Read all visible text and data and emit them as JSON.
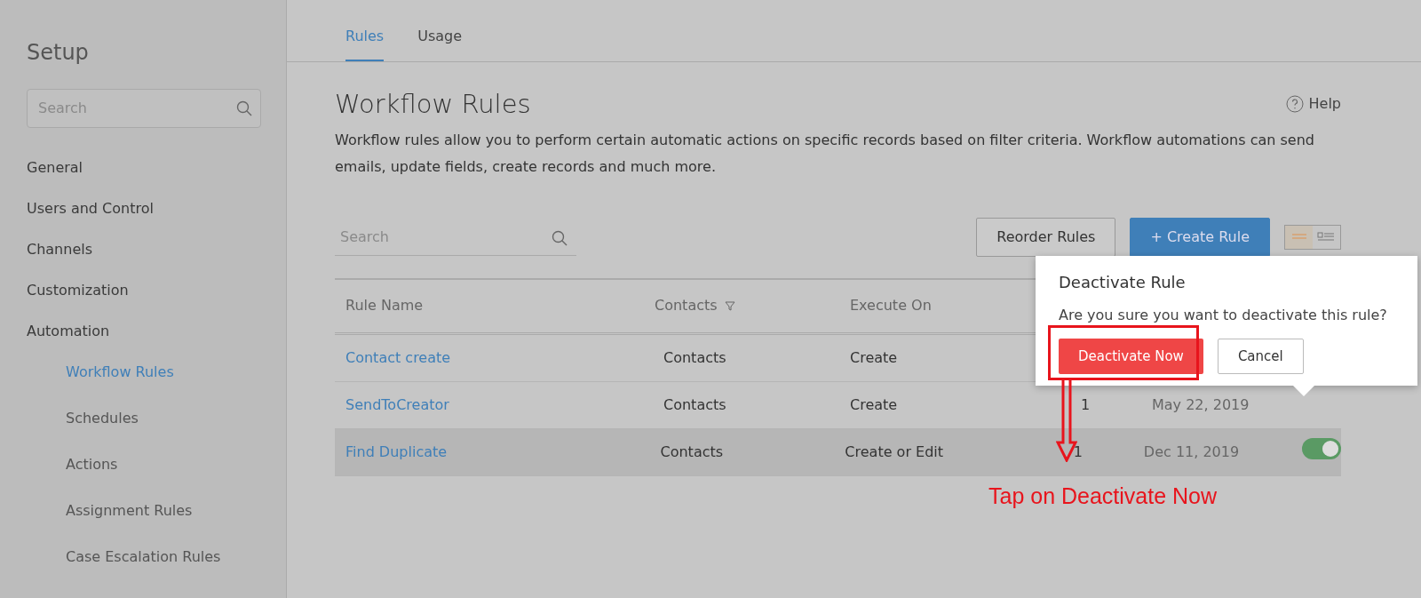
{
  "sidebar": {
    "title": "Setup",
    "search": {
      "placeholder": "Search"
    },
    "items": [
      {
        "label": "General"
      },
      {
        "label": "Users and Control"
      },
      {
        "label": "Channels"
      },
      {
        "label": "Customization"
      },
      {
        "label": "Automation",
        "children": [
          {
            "label": "Workflow Rules",
            "selected": true
          },
          {
            "label": "Schedules",
            "selected": false
          },
          {
            "label": "Actions",
            "selected": false
          },
          {
            "label": "Assignment Rules",
            "selected": false
          },
          {
            "label": "Case Escalation Rules",
            "selected": false
          }
        ]
      }
    ]
  },
  "tabs": [
    {
      "label": "Rules",
      "selected": true
    },
    {
      "label": "Usage",
      "selected": false
    }
  ],
  "page": {
    "title": "Workflow Rules",
    "help": "Help",
    "description": "Workflow rules allow you to perform certain automatic actions on specific records based on filter criteria. Workflow automations can send emails, update fields, create records and much more."
  },
  "toolbar": {
    "search": {
      "placeholder": "Search"
    },
    "buttons": [
      {
        "label": "Reorder Rules",
        "kind": "outline"
      },
      {
        "label": "+ Create Rule",
        "kind": "primary"
      }
    ],
    "views": [
      {
        "kind": "list",
        "selected": true
      },
      {
        "kind": "detail",
        "selected": false
      }
    ]
  },
  "table": {
    "columns": [
      "Rule Name",
      "Contacts",
      "Execute On"
    ],
    "rows": [
      {
        "name": "Contact create",
        "module": "Contacts",
        "execute_on": "Create",
        "highlighted": false
      },
      {
        "name": "SendToCreator",
        "module": "Contacts",
        "execute_on": "Create",
        "count": "1",
        "date": "May 22, 2019",
        "highlighted": false
      },
      {
        "name": "Find Duplicate",
        "module": "Contacts",
        "execute_on": "Create or Edit",
        "count": "1",
        "date": "Dec 11, 2019",
        "highlighted": true,
        "toggle": {
          "on": true
        }
      }
    ]
  },
  "dialog": {
    "title": "Deactivate Rule",
    "message": "Are you sure you want to deactivate this rule?",
    "buttons": [
      {
        "label": "Deactivate Now",
        "kind": "danger"
      },
      {
        "label": "Cancel",
        "kind": "outline"
      }
    ]
  },
  "annotation": {
    "text": "Tap on Deactivate Now"
  }
}
